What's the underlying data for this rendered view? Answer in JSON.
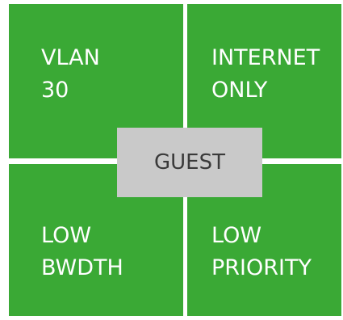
{
  "center_label": "GUEST",
  "colors": {
    "quadrant": "#3aa935",
    "center_box": "#c9c9c9",
    "center_text": "#3a3a3a",
    "quadrant_text": "#ffffff"
  },
  "quadrants": {
    "top_left": {
      "line1": "VLAN",
      "line2": "30"
    },
    "top_right": {
      "line1": "INTERNET",
      "line2": "ONLY"
    },
    "bottom_left": {
      "line1": "LOW",
      "line2": "BWDTH"
    },
    "bottom_right": {
      "line1": "LOW",
      "line2": "PRIORITY"
    }
  }
}
